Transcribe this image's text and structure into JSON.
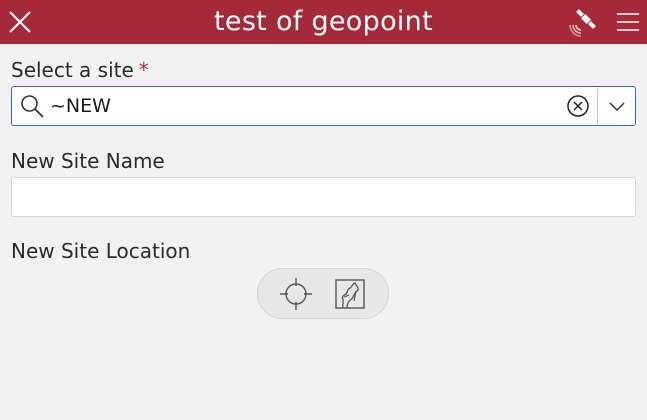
{
  "header": {
    "title": "test of geopoint",
    "background": "#a6293a",
    "icons": {
      "close": "close-icon",
      "gps": "satellite-icon",
      "menu": "hamburger-icon"
    }
  },
  "fields": {
    "site": {
      "label": "Select a site",
      "required_mark": "*",
      "value": "~NEW",
      "icons": {
        "search": "search-icon",
        "clear": "clear-circle-icon",
        "dropdown": "chevron-down-icon"
      }
    },
    "site_name": {
      "label": "New Site Name",
      "value": ""
    },
    "site_location": {
      "label": "New Site Location",
      "icons": {
        "locate": "crosshair-icon",
        "map": "map-icon"
      }
    }
  },
  "colors": {
    "accent": "#a6293a",
    "focus_border": "#2f6fa7",
    "background": "#f2f2f2"
  }
}
